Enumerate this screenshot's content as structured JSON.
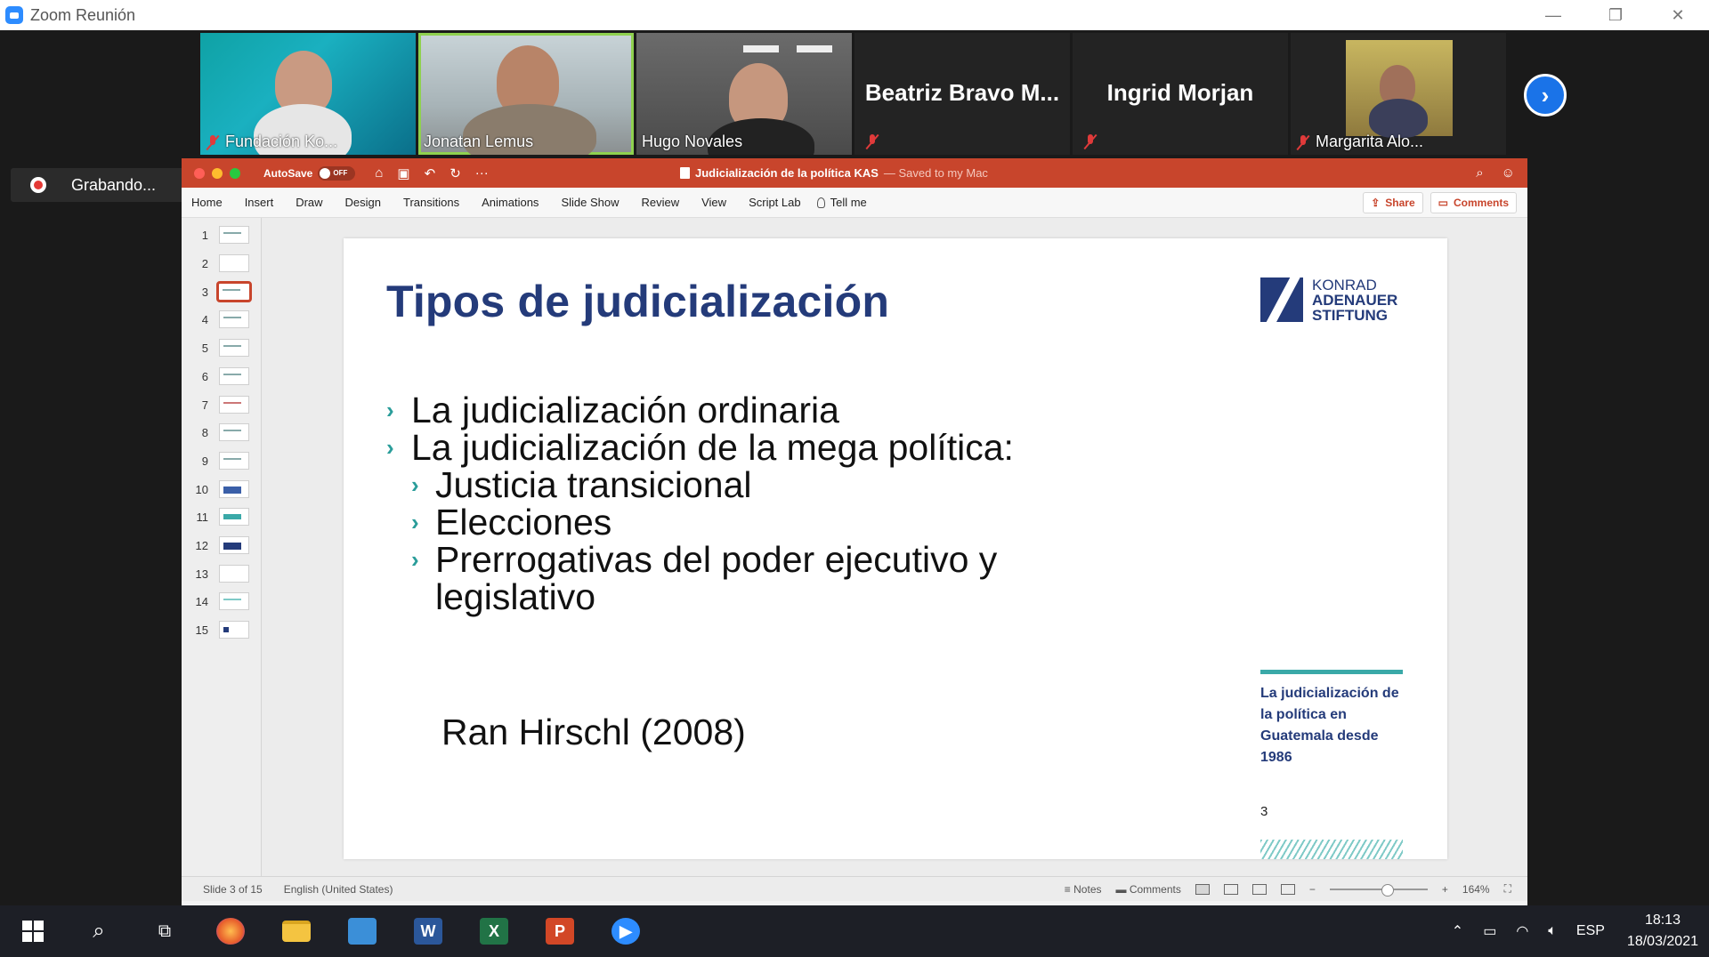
{
  "zoom": {
    "window_title": "Zoom Reunión",
    "recording_label": "Grabando...",
    "participants": [
      {
        "name": "Fundación Ko...",
        "muted": true
      },
      {
        "name": "Jonatan Lemus",
        "muted": false,
        "speaking": true
      },
      {
        "name": "Hugo Novales",
        "muted": false
      },
      {
        "name": "Beatriz Bravo M...",
        "muted": true,
        "video": false
      },
      {
        "name": "Ingrid Morjan",
        "muted": true,
        "video": false
      },
      {
        "name": "Margarita Alo...",
        "muted": true
      }
    ]
  },
  "ppt": {
    "autosave_label": "AutoSave",
    "autosave_state": "OFF",
    "doc_title": "Judicialización de la política KAS",
    "doc_status": "— Saved to my Mac",
    "tabs": [
      "Home",
      "Insert",
      "Draw",
      "Design",
      "Transitions",
      "Animations",
      "Slide Show",
      "Review",
      "View",
      "Script Lab"
    ],
    "tell_me": "Tell me",
    "share_label": "Share",
    "comments_label": "Comments",
    "thumbnails": [
      "1",
      "2",
      "3",
      "4",
      "5",
      "6",
      "7",
      "8",
      "9",
      "10",
      "11",
      "12",
      "13",
      "14",
      "15"
    ],
    "selected_slide": 3,
    "status": {
      "slide_position": "Slide 3 of 15",
      "language": "English (United States)",
      "notes_label": "Notes",
      "comments_label": "Comments",
      "zoom_level": "164%"
    }
  },
  "slide": {
    "title": "Tipos de judicialización",
    "logo_line1": "KONRAD",
    "logo_line2": "ADENAUER",
    "logo_line3": "STIFTUNG",
    "bullets": [
      "La judicialización ordinaria",
      "La judicialización de la mega política:"
    ],
    "sub_bullets": [
      "Justicia transicional",
      "Elecciones",
      "Prerrogativas del poder ejecutivo y",
      "legislativo"
    ],
    "author": "Ran Hirschl (2008)",
    "side_caption": "La judicialización de la política en Guatemala desde 1986",
    "page_number": "3"
  },
  "taskbar": {
    "language": "ESP",
    "time": "18:13",
    "date": "18/03/2021"
  },
  "colors": {
    "ppt_accent": "#c8452c",
    "slide_title": "#243b7a",
    "bullet_chevron": "#2a9d9a",
    "speaking_outline": "#8fd14f"
  }
}
